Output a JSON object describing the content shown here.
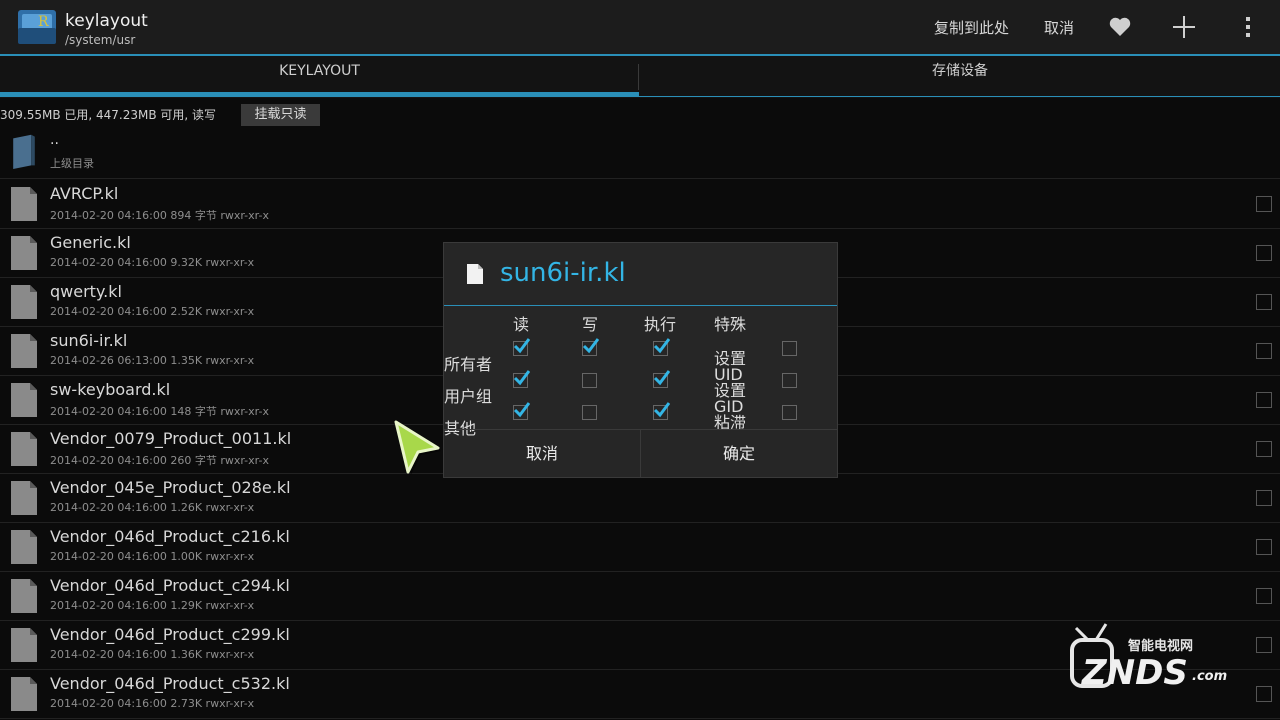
{
  "header": {
    "title": "keylayout",
    "path": "/system/usr",
    "copy_here": "复制到此处",
    "cancel": "取消",
    "icons": [
      "heart-icon",
      "plus-icon",
      "overflow-menu-icon"
    ]
  },
  "tabs": [
    {
      "label": "KEYLAYOUT",
      "active": true
    },
    {
      "label": "存储设备",
      "active": false
    }
  ],
  "storage": {
    "info": "309.55MB 已用, 447.23MB 可用, 读写",
    "mount_button": "挂载只读"
  },
  "parent": {
    "name": "..",
    "label": "上级目录"
  },
  "files": [
    {
      "name": "AVRCP.kl",
      "date": "2014-02-20 04:16:00",
      "size": "894 字节",
      "perm": "rwxr-xr-x"
    },
    {
      "name": "Generic.kl",
      "date": "2014-02-20 04:16:00",
      "size": "9.32K",
      "perm": "rwxr-xr-x"
    },
    {
      "name": "qwerty.kl",
      "date": "2014-02-20 04:16:00",
      "size": "2.52K",
      "perm": "rwxr-xr-x"
    },
    {
      "name": "sun6i-ir.kl",
      "date": "2014-02-26 06:13:00",
      "size": "1.35K",
      "perm": "rwxr-xr-x"
    },
    {
      "name": "sw-keyboard.kl",
      "date": "2014-02-20 04:16:00",
      "size": "148 字节",
      "perm": "rwxr-xr-x"
    },
    {
      "name": "Vendor_0079_Product_0011.kl",
      "date": "2014-02-20 04:16:00",
      "size": "260 字节",
      "perm": "rwxr-xr-x"
    },
    {
      "name": "Vendor_045e_Product_028e.kl",
      "date": "2014-02-20 04:16:00",
      "size": "1.26K",
      "perm": "rwxr-xr-x"
    },
    {
      "name": "Vendor_046d_Product_c216.kl",
      "date": "2014-02-20 04:16:00",
      "size": "1.00K",
      "perm": "rwxr-xr-x"
    },
    {
      "name": "Vendor_046d_Product_c294.kl",
      "date": "2014-02-20 04:16:00",
      "size": "1.29K",
      "perm": "rwxr-xr-x"
    },
    {
      "name": "Vendor_046d_Product_c299.kl",
      "date": "2014-02-20 04:16:00",
      "size": "1.36K",
      "perm": "rwxr-xr-x"
    },
    {
      "name": "Vendor_046d_Product_c532.kl",
      "date": "2014-02-20 04:16:00",
      "size": "2.73K",
      "perm": "rwxr-xr-x"
    }
  ],
  "dialog": {
    "title": "sun6i-ir.kl",
    "columns": [
      "读",
      "写",
      "执行",
      "特殊"
    ],
    "rows": [
      {
        "label": "所有者",
        "read": true,
        "write": true,
        "exec": true,
        "special": "设置UID",
        "special_checked": false
      },
      {
        "label": "用户组",
        "read": true,
        "write": false,
        "exec": true,
        "special": "设置GID",
        "special_checked": false
      },
      {
        "label": "其他",
        "read": true,
        "write": false,
        "exec": true,
        "special": "粘滞",
        "special_checked": false
      }
    ],
    "cancel": "取消",
    "ok": "确定"
  },
  "watermark": {
    "top": "智能电视网",
    "main": "ZNDS",
    "suffix": ".com"
  },
  "colors": {
    "accent": "#33b5e5",
    "bar": "#2a8fb8",
    "background": "#0b0b0b"
  }
}
